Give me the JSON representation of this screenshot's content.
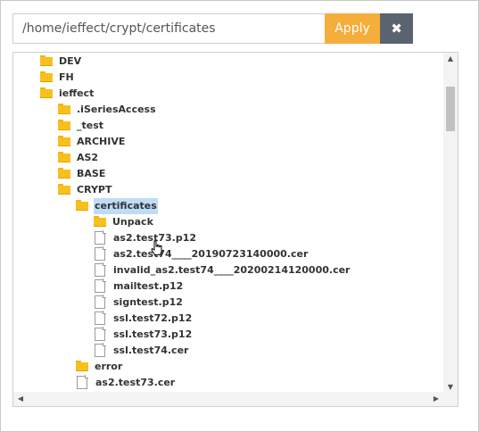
{
  "path_bar": {
    "path_value": "/home/ieffect/crypt/certificates",
    "apply_label": "Apply",
    "close_label": "✖"
  },
  "tree": {
    "nodes": [
      {
        "label": "DEV",
        "kind": "folder",
        "depth": 1,
        "selected": false
      },
      {
        "label": "FH",
        "kind": "folder",
        "depth": 1,
        "selected": false
      },
      {
        "label": "ieffect",
        "kind": "folder",
        "depth": 1,
        "selected": false
      },
      {
        "label": ".iSeriesAccess",
        "kind": "folder",
        "depth": 2,
        "selected": false
      },
      {
        "label": "_test",
        "kind": "folder",
        "depth": 2,
        "selected": false
      },
      {
        "label": "ARCHIVE",
        "kind": "folder",
        "depth": 2,
        "selected": false
      },
      {
        "label": "AS2",
        "kind": "folder",
        "depth": 2,
        "selected": false
      },
      {
        "label": "BASE",
        "kind": "folder",
        "depth": 2,
        "selected": false
      },
      {
        "label": "CRYPT",
        "kind": "folder",
        "depth": 2,
        "selected": false
      },
      {
        "label": "certificates",
        "kind": "folder",
        "depth": 3,
        "selected": true
      },
      {
        "label": "Unpack",
        "kind": "folder",
        "depth": 4,
        "selected": false
      },
      {
        "label": "as2.test73.p12",
        "kind": "file",
        "depth": 4,
        "selected": false
      },
      {
        "label": "as2.test74____20190723140000.cer",
        "kind": "file",
        "depth": 4,
        "selected": false
      },
      {
        "label": "invalid_as2.test74____20200214120000.cer",
        "kind": "file",
        "depth": 4,
        "selected": false
      },
      {
        "label": "mailtest.p12",
        "kind": "file",
        "depth": 4,
        "selected": false
      },
      {
        "label": "signtest.p12",
        "kind": "file",
        "depth": 4,
        "selected": false
      },
      {
        "label": "ssl.test72.p12",
        "kind": "file",
        "depth": 4,
        "selected": false
      },
      {
        "label": "ssl.test73.p12",
        "kind": "file",
        "depth": 4,
        "selected": false
      },
      {
        "label": "ssl.test74.cer",
        "kind": "file",
        "depth": 4,
        "selected": false
      },
      {
        "label": "error",
        "kind": "folder",
        "depth": 3,
        "selected": false
      },
      {
        "label": "as2.test73.cer",
        "kind": "file",
        "depth": 3,
        "selected": false
      }
    ]
  },
  "scrollbars": {
    "up_arrow": "▲",
    "down_arrow": "▼",
    "left_arrow": "◀",
    "right_arrow": "▶"
  }
}
